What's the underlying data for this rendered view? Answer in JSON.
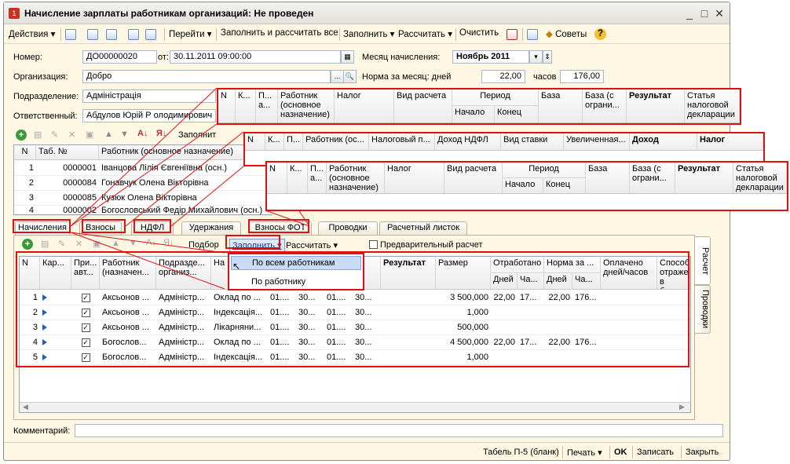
{
  "window": {
    "title": "Начисление зарплаты работникам организаций: Не проведен"
  },
  "toolbar": {
    "actions": "Действия",
    "go": "Перейти",
    "fill_calc_all": "Заполнить и рассчитать все",
    "fill": "Заполнить",
    "calc": "Рассчитать",
    "clear": "Очистить",
    "tips": "Советы"
  },
  "header": {
    "number_label": "Номер:",
    "number": "ДО00000020",
    "from_label": "от:",
    "date": "30.11.2011 09:00:00",
    "month_label": "Месяц начисления:",
    "month": "Ноябрь 2011",
    "org_label": "Организация:",
    "org": "Добро",
    "norm_label": "Норма за месяц: дней",
    "norm_days": "22,00",
    "hours_label": "часов",
    "norm_hours": "176,00",
    "dept_label": "Подразделение:",
    "dept": "Адміністрація",
    "resp_label": "Ответственный:",
    "resp": "Абдулов Юрій Р олодимирович"
  },
  "upper_toolbar": {
    "fill": "Заполнит"
  },
  "emp_grid": {
    "headers": [
      "N",
      "Таб. №",
      "Работник (основное назначение)"
    ],
    "rows": [
      [
        "1",
        "0000001",
        "Іванцова Лілія Євгеніївна (осн.)"
      ],
      [
        "2",
        "0000084",
        "Гонавчук Олена Вікторівна"
      ],
      [
        "3",
        "0000085",
        "Кузюк Олена Вікторівна"
      ],
      [
        "4",
        "0000002",
        "Богословський Федір Михайлович (осн.)"
      ]
    ]
  },
  "tabs": [
    "Начисления",
    "Взносы",
    "НДФЛ",
    "Удержания",
    "Взносы ФОТ",
    "Проводки",
    "Расчетный листок"
  ],
  "tab_toolbar": {
    "podbor": "Подбор",
    "fill": "Заполнить",
    "calc": "Рассчитать",
    "prelim": "Предварительный расчет"
  },
  "fill_menu": {
    "items": [
      "По всем работникам",
      "По работнику"
    ]
  },
  "main_grid": {
    "headers": {
      "n": "N",
      "kar": "Кар...",
      "pri": "При... авт...",
      "worker": "Работник (назначен...",
      "dept": "Подразде... организ...",
      "na": "На",
      "result": "Результат",
      "size": "Размер",
      "worked": "Отработано",
      "days": "Дней",
      "hours": "Ча...",
      "norm": "Норма за ...",
      "ndays": "Дней",
      "nhours": "Ча...",
      "paid": "Оплачено дней/часов",
      "method": "Способ отраже... в бухуч..."
    },
    "rows": [
      {
        "n": "1",
        "worker": "Аксьонов ...",
        "dept": "Адміністр...",
        "type": "Оклад по ...",
        "d1": "01....",
        "d2": "30...",
        "d3": "01....",
        "d4": "30...",
        "size": "3 500,000",
        "wd": "22,00",
        "wh": "17...",
        "nd": "22,00",
        "nh": "176..."
      },
      {
        "n": "2",
        "worker": "Аксьонов ...",
        "dept": "Адміністр...",
        "type": "Індексація...",
        "d1": "01....",
        "d2": "30...",
        "d3": "01....",
        "d4": "30...",
        "size": "1,000",
        "wd": "",
        "wh": "",
        "nd": "",
        "nh": ""
      },
      {
        "n": "3",
        "worker": "Аксьонов ...",
        "dept": "Адміністр...",
        "type": "Лікарняни...",
        "d1": "01....",
        "d2": "30...",
        "d3": "01....",
        "d4": "30...",
        "size": "500,000",
        "wd": "",
        "wh": "",
        "nd": "",
        "nh": ""
      },
      {
        "n": "4",
        "worker": "Богослов...",
        "dept": "Адміністр...",
        "type": "Оклад по ...",
        "d1": "01....",
        "d2": "30...",
        "d3": "01....",
        "d4": "30...",
        "size": "4 500,000",
        "wd": "22,00",
        "wh": "17...",
        "nd": "22,00",
        "nh": "176..."
      },
      {
        "n": "5",
        "worker": "Богослов...",
        "dept": "Адміністр...",
        "type": "Індексація...",
        "d1": "01....",
        "d2": "30...",
        "d3": "01....",
        "d4": "30...",
        "size": "1,000",
        "wd": "",
        "wh": "",
        "nd": "",
        "nh": ""
      }
    ]
  },
  "side_tabs": [
    "Расчет",
    "Проводки"
  ],
  "comment_label": "Комментарий:",
  "bottom": {
    "tabel": "Табель П-5 (бланк)",
    "print": "Печать",
    "ok": "OK",
    "save": "Записать",
    "close": "Закрыть"
  },
  "callout1": {
    "n": "N",
    "k": "К...",
    "p": "П... а...",
    "worker": "Работник (основное назначение)",
    "tax": "Налог",
    "kind": "Вид расчета",
    "period": "Период",
    "start": "Начало",
    "end": "Конец",
    "base": "База",
    "base_lim": "База (с ограни...",
    "result": "Результат",
    "article": "Статья налоговой декларации"
  },
  "callout2": {
    "n": "N",
    "k": "К...",
    "p": "П...",
    "worker": "Работник (ос...",
    "tax_type": "Налоговый п...",
    "income": "Доход НДФЛ",
    "rate": "Вид ставки",
    "inc": "Увеличенная...",
    "dohod": "Доход",
    "nalog": "Налог"
  },
  "callout3": {
    "n": "N",
    "k": "К...",
    "p": "П... а...",
    "worker": "Работник (основное назначение)",
    "tax": "Налог",
    "kind": "Вид расчета",
    "period": "Период",
    "start": "Начало",
    "end": "Конец",
    "base": "База",
    "base_lim": "База (с ограни...",
    "result": "Результат",
    "article": "Статья налоговой декларации"
  }
}
